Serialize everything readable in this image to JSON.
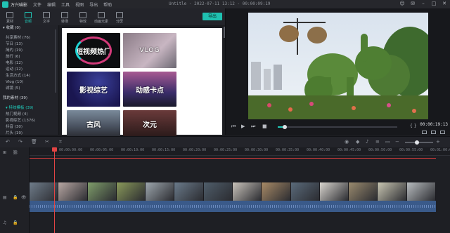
{
  "app": {
    "name": "万兴喵影",
    "menus": [
      "文件",
      "编辑",
      "工具",
      "视图",
      "导出",
      "帮助"
    ],
    "window_title": "Untitle - 2022-07-11 13:12 - 00:00:09:19"
  },
  "media_tabs": [
    {
      "label": "素材"
    },
    {
      "label": "音频"
    },
    {
      "label": "文字"
    },
    {
      "label": "转场"
    },
    {
      "label": "特效"
    },
    {
      "label": "动画元素"
    },
    {
      "label": "分屏"
    }
  ],
  "export_label": "导出",
  "sidebar": {
    "rows": [
      {
        "text": "▾ 收藏 (0)",
        "type": "head"
      },
      {
        "text": "",
        "type": "gap"
      },
      {
        "text": "共享素材 (76)",
        "type": "item"
      },
      {
        "text": "节日 (13)",
        "type": "item"
      },
      {
        "text": "简约 (19)",
        "type": "item"
      },
      {
        "text": "旅行 (6)",
        "type": "item"
      },
      {
        "text": "电影 (12)",
        "type": "item"
      },
      {
        "text": "运动 (12)",
        "type": "item"
      },
      {
        "text": "生活方式 (14)",
        "type": "item"
      },
      {
        "text": "Vlog (10)",
        "type": "item"
      },
      {
        "text": "滤镜 (5)",
        "type": "item"
      },
      {
        "text": "",
        "type": "gap"
      },
      {
        "text": "我的素材 (39)",
        "type": "head"
      },
      {
        "text": "",
        "type": "gap"
      },
      {
        "text": "▾ 特效模板 (39)",
        "type": "sel"
      },
      {
        "text": "热门视频 (4)",
        "type": "item"
      },
      {
        "text": "影视综艺 (1376)",
        "type": "item"
      },
      {
        "text": "抖音 (30)",
        "type": "item"
      },
      {
        "text": "片头 (19)",
        "type": "item"
      }
    ]
  },
  "thumbnails": [
    {
      "title": "短视频热门"
    },
    {
      "title": "VLOG"
    },
    {
      "title": "影视综艺"
    },
    {
      "title": "动感卡点"
    },
    {
      "title": "古风"
    },
    {
      "title": "次元"
    }
  ],
  "preview": {
    "timecode": "00:00:19:13",
    "progress_fraction": 0.06
  },
  "timeline": {
    "ruler_labels": [
      "00:00:00:00",
      "00:00:05:00",
      "00:00:10:00",
      "00:00:15:00",
      "00:00:20:00",
      "00:00:25:00",
      "00:00:30:00",
      "00:00:35:00",
      "00:00:40:00",
      "00:00:45:00",
      "00:00:50:00",
      "00:00:55:00",
      "00:01:00:00"
    ],
    "clips": [
      {
        "color": "#6f7c8a"
      },
      {
        "color": "#b8a7a3"
      },
      {
        "color": "#7f9d6a"
      },
      {
        "color": "#8a9a5a"
      },
      {
        "color": "#9ea7ae"
      },
      {
        "color": "#6a7a8a"
      },
      {
        "color": "#4f5d6a"
      },
      {
        "color": "#c9c3bb"
      },
      {
        "color": "#a88a66"
      },
      {
        "color": "#5a6a7a"
      },
      {
        "color": "#d8d4ce"
      },
      {
        "color": "#9a8a6e"
      },
      {
        "color": "#c9c6b2"
      },
      {
        "color": "#b8bcbf"
      }
    ]
  }
}
